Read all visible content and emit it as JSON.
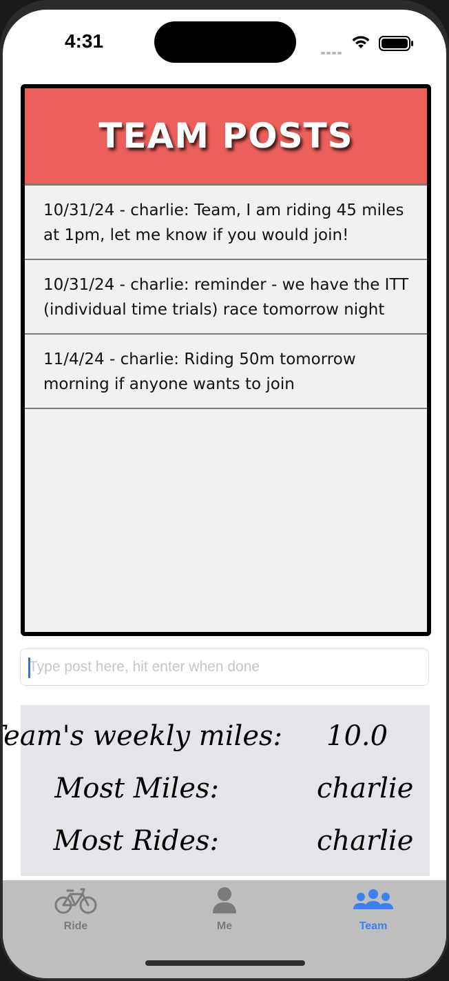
{
  "status_bar": {
    "time": "4:31"
  },
  "posts_panel": {
    "title": "TEAM POSTS",
    "posts": [
      "10/31/24 - charlie: Team, I am riding 45 miles at 1pm, let me know if you would join!",
      "10/31/24 - charlie: reminder - we have the ITT (individual time trials) race tomorrow night",
      "11/4/24 - charlie: Riding 50m tomorrow morning if anyone wants to join"
    ]
  },
  "post_input": {
    "placeholder": "Type post here, hit enter when done",
    "value": ""
  },
  "stats": {
    "weekly_miles_label": "Team's weekly miles:",
    "weekly_miles_value": "10.0",
    "most_miles_label": "Most Miles:",
    "most_miles_value": "charlie",
    "most_rides_label": "Most Rides:",
    "most_rides_value": "charlie"
  },
  "tabbar": {
    "tabs": [
      {
        "label": "Ride",
        "icon": "bicycle-icon",
        "active": false
      },
      {
        "label": "Me",
        "icon": "person-icon",
        "active": false
      },
      {
        "label": "Team",
        "icon": "people-icon",
        "active": true
      }
    ]
  },
  "colors": {
    "header_red": "#ec5f5b",
    "active_tab": "#3b82f0",
    "inactive_tab": "#7b7b7b",
    "tabbar_bg": "#bebebe",
    "stats_bg": "#e4e4e9"
  }
}
